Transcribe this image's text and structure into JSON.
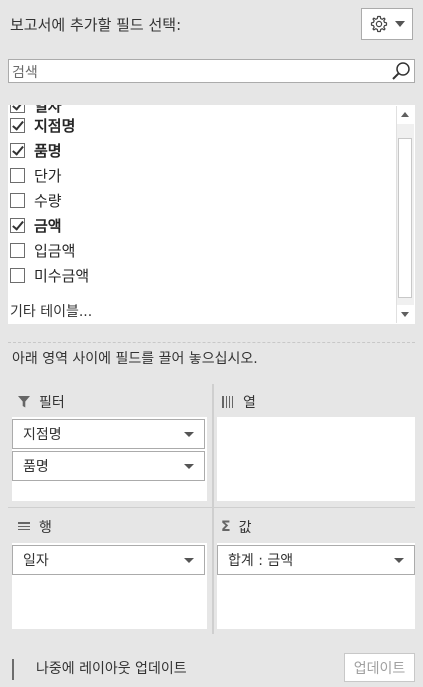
{
  "header": {
    "title": "보고서에 추가할 필드 선택:"
  },
  "search": {
    "placeholder": "검색"
  },
  "fields": [
    {
      "label": "일자",
      "checked": true,
      "bold": true,
      "partial": true
    },
    {
      "label": "지점명",
      "checked": true,
      "bold": true
    },
    {
      "label": "품명",
      "checked": true,
      "bold": true
    },
    {
      "label": "단가",
      "checked": false,
      "bold": false
    },
    {
      "label": "수량",
      "checked": false,
      "bold": false
    },
    {
      "label": "금액",
      "checked": true,
      "bold": true
    },
    {
      "label": "입금액",
      "checked": false,
      "bold": false
    },
    {
      "label": "미수금액",
      "checked": false,
      "bold": false
    }
  ],
  "more_tables": "기타 테이블...",
  "instruction": "아래 영역 사이에 필드를 끌어 놓으십시오.",
  "areas": {
    "filters": {
      "title": "필터",
      "icon": "filter-icon",
      "items": [
        "지점명",
        "품명"
      ]
    },
    "columns": {
      "title": "열",
      "icon": "columns-icon",
      "items": []
    },
    "rows": {
      "title": "행",
      "icon": "rows-icon",
      "items": [
        "일자"
      ]
    },
    "values": {
      "title": "값",
      "icon": "sigma-icon",
      "items": [
        "합계 : 금액"
      ]
    }
  },
  "footer": {
    "defer_label": "나중에 레이아웃 업데이트",
    "update_label": "업데이트"
  }
}
